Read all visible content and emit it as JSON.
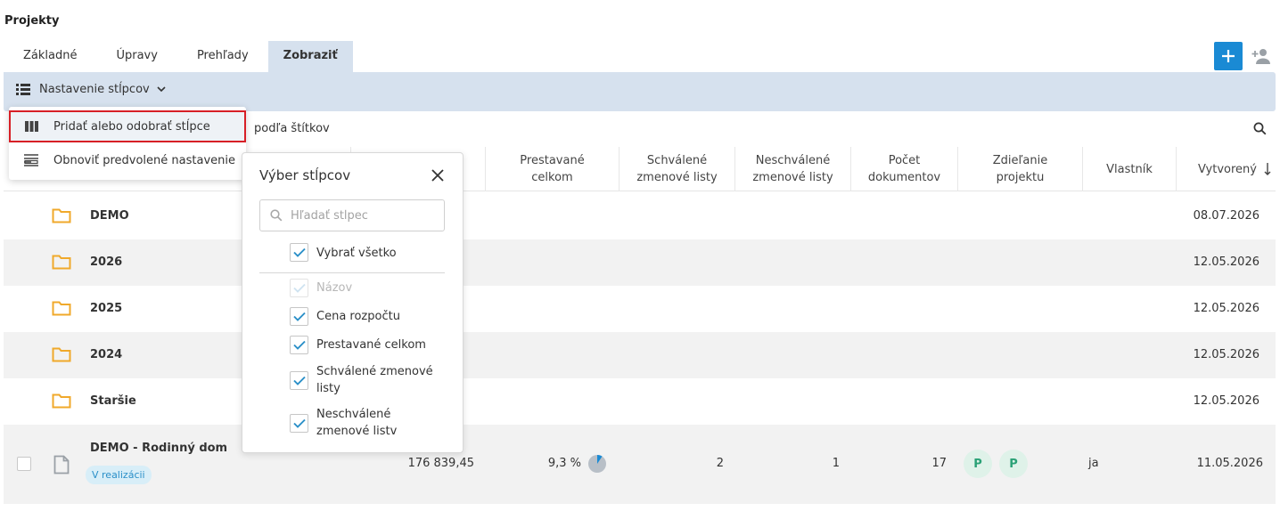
{
  "page": {
    "title": "Projekty"
  },
  "tabs": [
    {
      "label": "Základné",
      "active": false
    },
    {
      "label": "Úpravy",
      "active": false
    },
    {
      "label": "Prehľady",
      "active": false
    },
    {
      "label": "Zobraziť",
      "active": true
    }
  ],
  "toolbar": {
    "columns_settings_label": "Nastavenie stĺpcov"
  },
  "dropdown": {
    "items": [
      {
        "label": "Pridať alebo odobrať stĺpce",
        "icon": "columns-icon"
      },
      {
        "label": "Obnoviť predvolené nastavenie",
        "icon": "reset-layout-icon"
      }
    ]
  },
  "filter": {
    "text": "podľa štítkov"
  },
  "table": {
    "headers": [
      "Prestavané celkom",
      "Schválené zmenové listy",
      "Neschválené zmenové listy",
      "Počet dokumentov",
      "Zdieľanie projektu",
      "Vlastník",
      "Vytvorený"
    ],
    "folder_rows": [
      {
        "name": "DEMO",
        "date": "08.07.2026"
      },
      {
        "name": "2026",
        "date": "12.05.2026"
      },
      {
        "name": "2025",
        "date": "12.05.2026"
      },
      {
        "name": "2024",
        "date": "12.05.2026"
      },
      {
        "name": "Staršie",
        "date": "12.05.2026"
      }
    ],
    "project_row": {
      "name": "DEMO - Rodinný dom",
      "status": "V realizácii",
      "budget": "176 839,45",
      "rebuilt_pct": "9,3 %",
      "rebuilt_fraction": 0.093,
      "approved": "2",
      "unapproved": "1",
      "documents": "17",
      "shares": [
        "P",
        "P"
      ],
      "owner": "ja",
      "created": "11.05.2026"
    }
  },
  "column_picker": {
    "title": "Výber stĺpcov",
    "search_placeholder": "Hľadať stĺpec",
    "select_all": "Vybrať všetko",
    "options": [
      {
        "label": "Názov",
        "checked": true,
        "disabled": true
      },
      {
        "label": "Cena rozpočtu",
        "checked": true,
        "disabled": false
      },
      {
        "label": "Prestavané celkom",
        "checked": true,
        "disabled": false
      },
      {
        "label": "Schválené zmenové listy",
        "checked": true,
        "disabled": false
      },
      {
        "label": "Neschválené zmenové listv",
        "checked": true,
        "disabled": false
      }
    ]
  },
  "colors": {
    "accent": "#1a8ad4",
    "toolbar_bg": "#d6e1ee",
    "folder": "#f0a92b",
    "highlight_border": "#d71f26",
    "check": "#2a8fc8"
  }
}
